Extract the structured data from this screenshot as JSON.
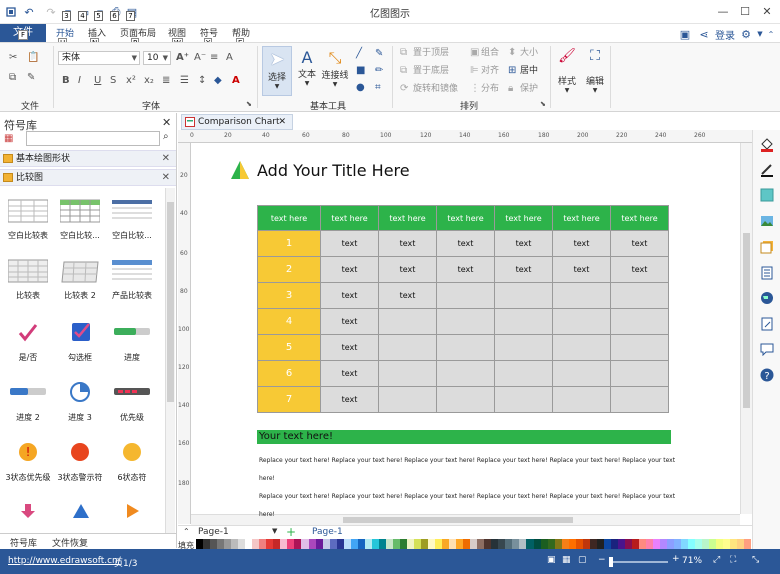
{
  "app": {
    "title": "亿图图示",
    "login": "登录"
  },
  "quick_access": {
    "keys": [
      "3",
      "4",
      "5",
      "6",
      "7"
    ]
  },
  "ribbon_tabs": {
    "file": "文件",
    "file_key": "F",
    "tabs": [
      {
        "label": "开始",
        "key": "H"
      },
      {
        "label": "插入",
        "key": "N"
      },
      {
        "label": "页面布局",
        "key": "P"
      },
      {
        "label": "视图",
        "key": "W"
      },
      {
        "label": "符号",
        "key": "Y"
      },
      {
        "label": "帮助",
        "key": "E"
      }
    ]
  },
  "ribbon": {
    "groups": {
      "file": "文件",
      "font": "字体",
      "basic_tools": "基本工具",
      "arrange": "排列"
    },
    "font": {
      "name": "宋体",
      "size": "10"
    },
    "tools": {
      "select": "选择",
      "text": "文本",
      "connector": "连接线"
    },
    "arrange": {
      "bring_front": "置于顶层",
      "send_back": "置于底层",
      "rotate": "旋转和镜像",
      "group": "组合",
      "align": "对齐",
      "distribute": "分布",
      "size": "大小",
      "center": "居中",
      "protect": "保护"
    },
    "style": "样式",
    "edit": "编辑"
  },
  "library": {
    "title": "符号库",
    "categories": [
      "基本绘图形状",
      "比较图"
    ],
    "shapes": [
      "空白比较表",
      "空白比较...",
      "空白比较...",
      "比较表",
      "比较表 2",
      "产品比较表",
      "是/否",
      "勾选框",
      "进度",
      "进度 2",
      "进度 3",
      "优先级",
      "3状态优先级",
      "3状态警示符",
      "6状态符"
    ],
    "bottom_tabs": [
      "符号库",
      "文件恢复"
    ]
  },
  "document": {
    "tab": "Comparison Chart",
    "title": "Add Your Title Here",
    "banner": "Your text here!"
  },
  "ruler": {
    "h": [
      "0",
      "20",
      "40",
      "60",
      "80",
      "100",
      "120",
      "140",
      "160",
      "180",
      "200",
      "220",
      "240",
      "260"
    ],
    "v": [
      "20",
      "40",
      "60",
      "80",
      "100",
      "120",
      "140",
      "160",
      "180"
    ]
  },
  "table": {
    "header": [
      "text here",
      "text here",
      "text here",
      "text here",
      "text here",
      "text here",
      "text here"
    ],
    "rows": [
      {
        "n": "1",
        "cells": [
          "text",
          "text",
          "text",
          "text",
          "text",
          "text"
        ]
      },
      {
        "n": "2",
        "cells": [
          "text",
          "text",
          "text",
          "text",
          "text",
          "text"
        ]
      },
      {
        "n": "3",
        "cells": [
          "text",
          "text",
          "",
          "",
          "",
          ""
        ]
      },
      {
        "n": "4",
        "cells": [
          "text",
          "",
          "",
          "",
          "",
          ""
        ]
      },
      {
        "n": "5",
        "cells": [
          "text",
          "",
          "",
          "",
          "",
          ""
        ]
      },
      {
        "n": "6",
        "cells": [
          "text",
          "",
          "",
          "",
          "",
          ""
        ]
      },
      {
        "n": "7",
        "cells": [
          "text",
          "",
          "",
          "",
          "",
          ""
        ]
      }
    ]
  },
  "body_text": "Replace your text here!",
  "pages": {
    "current": "Page-1",
    "tab": "Page-1"
  },
  "fill_label": "填充",
  "status": {
    "url": "http://www.edrawsoft.cn/",
    "page": "页1/3",
    "zoom": "71%"
  },
  "colors": {
    "accent": "#2b5797",
    "green": "#2db34a",
    "yellow": "#f7c935",
    "grey": "#dcdcdc"
  }
}
